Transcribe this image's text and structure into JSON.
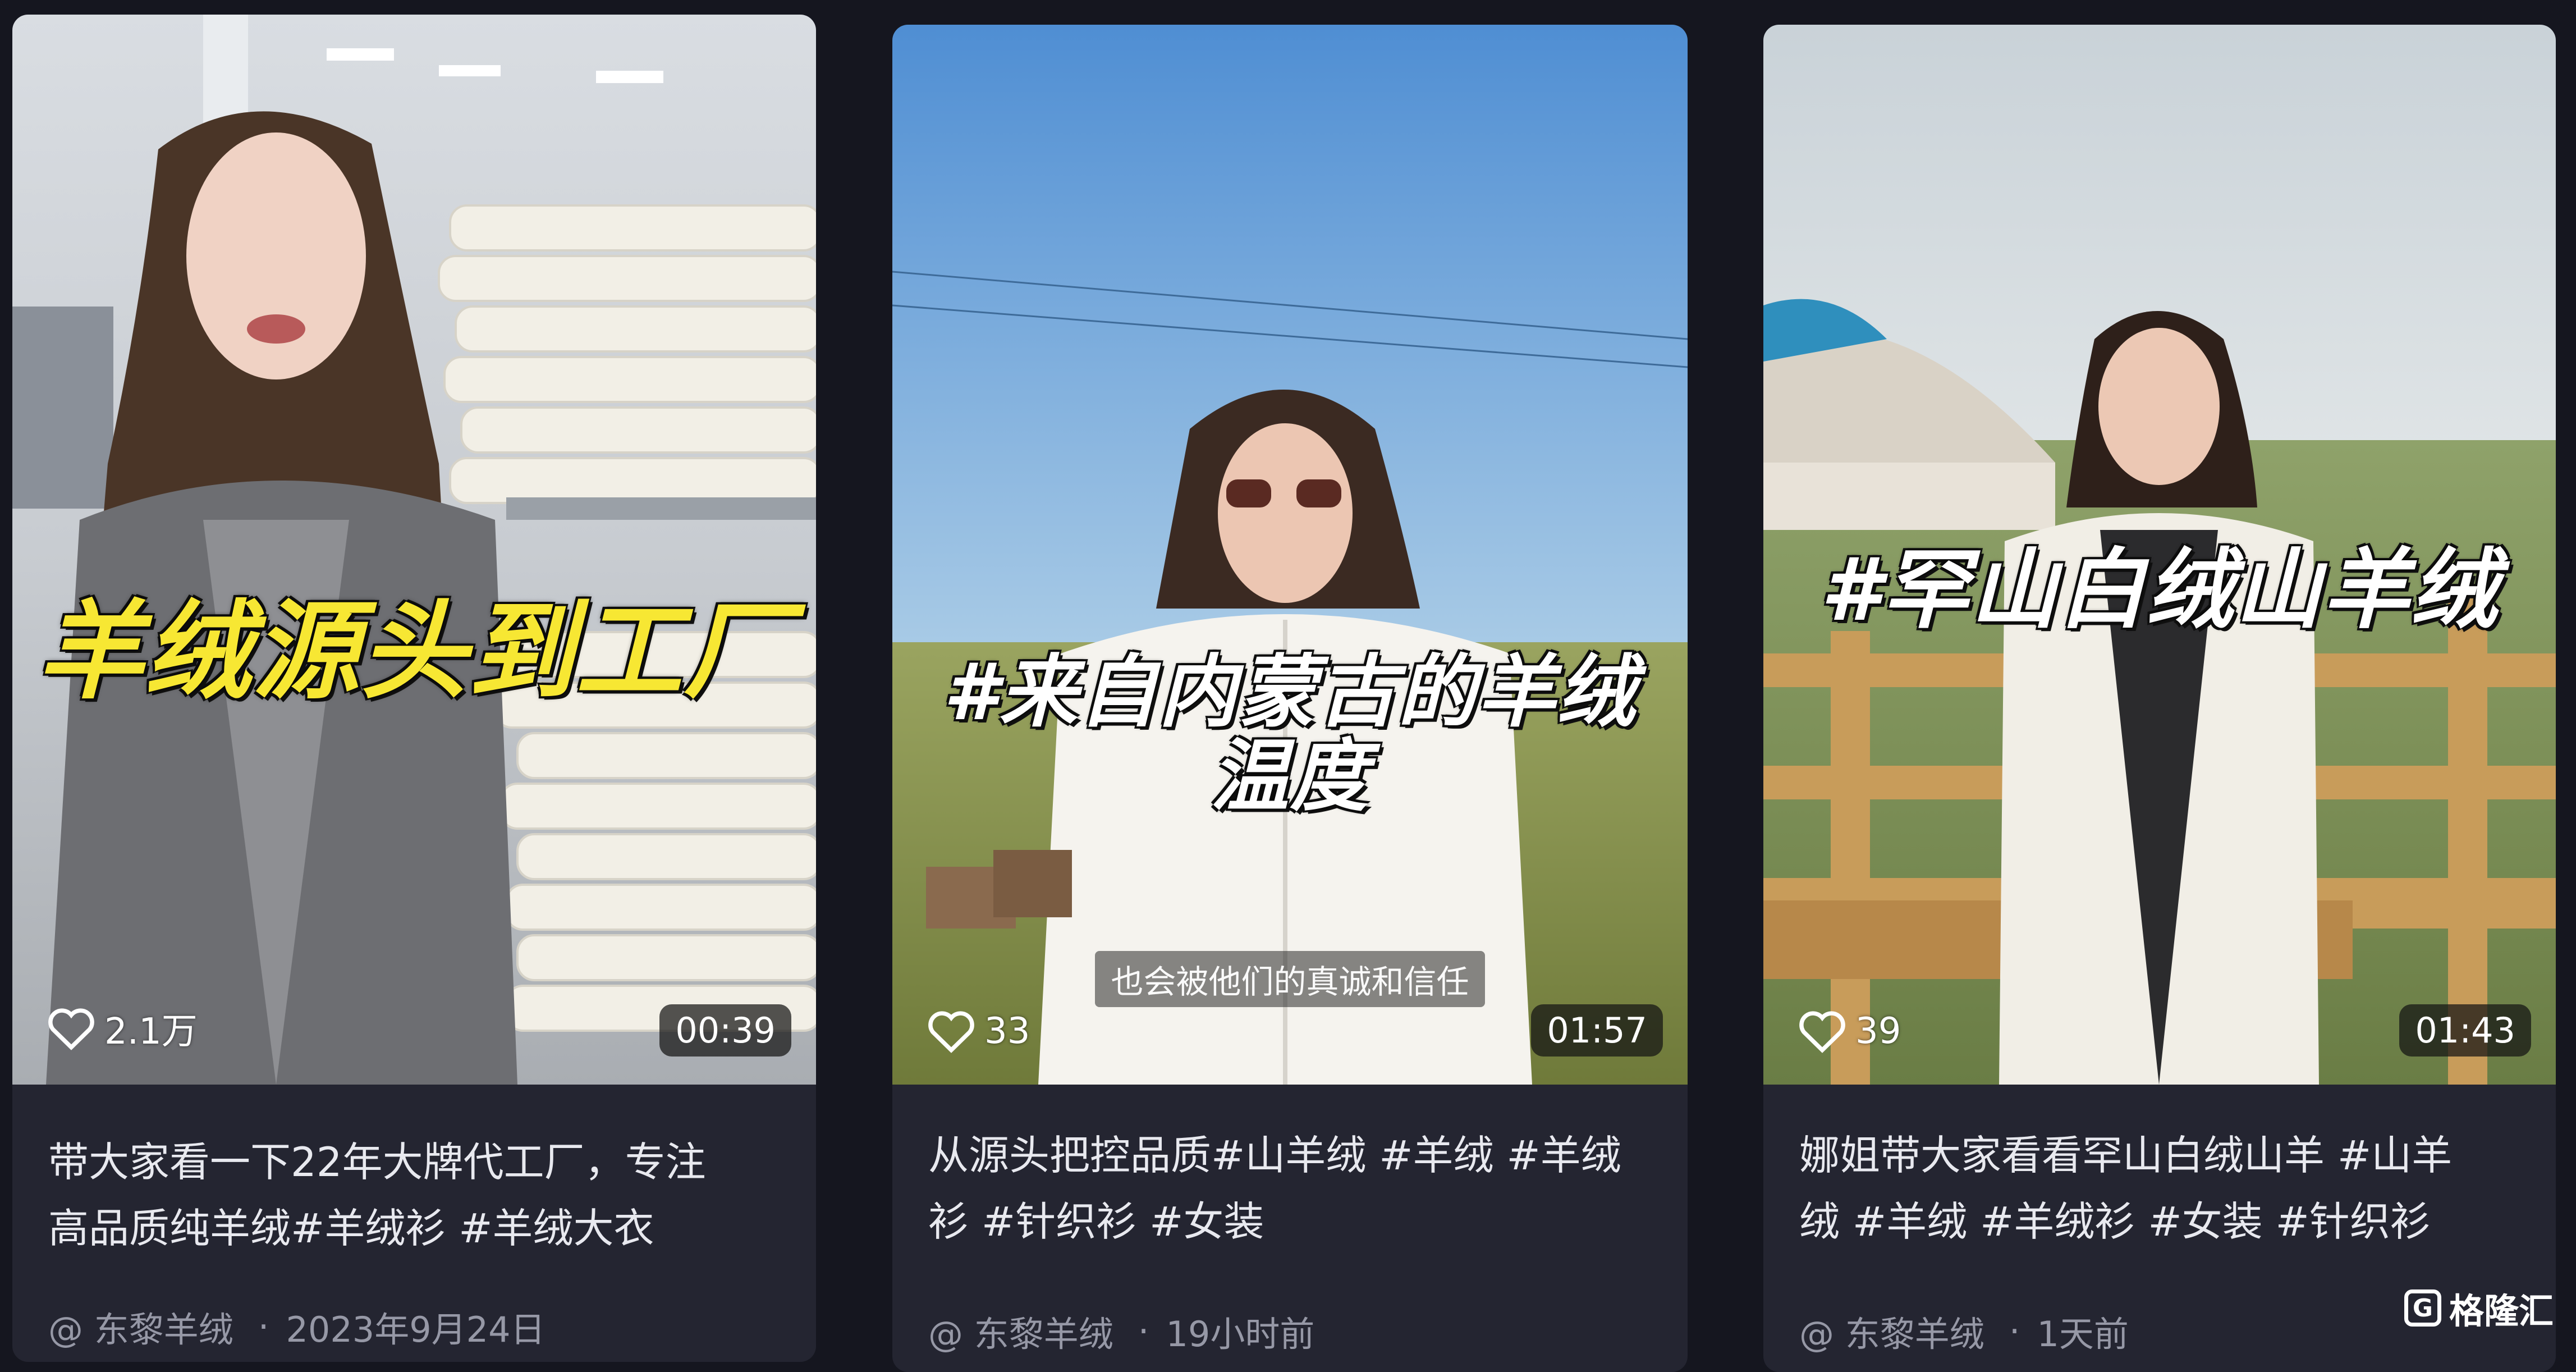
{
  "colors": {
    "page_bg": "#15161f",
    "card_bg": "#242531",
    "text": "#e8e9ef",
    "muted": "#9698a6",
    "overlay_yellow": "#f7e733"
  },
  "cards": [
    {
      "overlay_title": "羊绒源头到工厂",
      "subtitle": "",
      "likes": "2.1万",
      "like_icon": "heart-outline-icon",
      "duration": "00:39",
      "desc_line1": "带大家看一下22年大牌代工厂，专注",
      "desc_line2": "高品质纯羊绒#羊绒衫 #羊绒大衣",
      "author": "@ 东黎羊绒",
      "separator": "·",
      "time": "2023年9月24日"
    },
    {
      "overlay_title": "#来自内蒙古的羊绒",
      "overlay_title_line2": "温度",
      "subtitle": "也会被他们的真诚和信任",
      "likes": "33",
      "like_icon": "heart-outline-icon",
      "duration": "01:57",
      "desc_line1": "从源头把控品质#山羊绒 #羊绒 #羊绒",
      "desc_line2": "衫 #针织衫 #女装",
      "author": "@ 东黎羊绒",
      "separator": "·",
      "time": "19小时前"
    },
    {
      "overlay_title": "#罕山白绒山羊绒",
      "subtitle": "",
      "likes": "39",
      "like_icon": "heart-outline-icon",
      "duration": "01:43",
      "desc_line1": "娜姐带大家看看罕山白绒山羊 #山羊",
      "desc_line2": "绒 #羊绒 #羊绒衫 #女装 #针织衫",
      "author": "@ 东黎羊绒",
      "separator": "·",
      "time": "1天前"
    }
  ],
  "watermark": {
    "logo_icon": "gelonghui-logo-icon",
    "text": "格隆汇"
  }
}
